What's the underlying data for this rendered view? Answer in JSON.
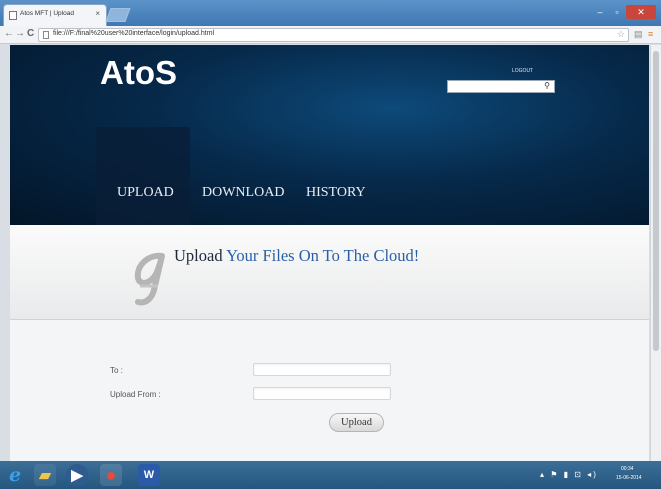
{
  "browser": {
    "tab_title": "Atos MFT | Upload",
    "tab_close": "×",
    "url": "file:///F:/final%20user%20interface/login/upload.html",
    "back": "←",
    "forward": "→",
    "reload": "C",
    "star": "☆",
    "menu": "≡",
    "extension": "▤",
    "window_controls": {
      "minimize": "–",
      "maximize": "▫",
      "close": "✕"
    }
  },
  "header": {
    "logo": "AtoS",
    "logout": "LOGOUT",
    "search_placeholder": "",
    "search_icon": "⚲"
  },
  "nav": [
    {
      "label": "UPLOAD",
      "active": true
    },
    {
      "label": "DOWNLOAD",
      "active": false
    },
    {
      "label": "HISTORY",
      "active": false
    }
  ],
  "banner": {
    "logo_glyph": "𝒜",
    "title_prefix": "Upload",
    "title_highlight": " Your Files On To The Cloud!"
  },
  "form": {
    "to_label": "To :",
    "to_value": "",
    "from_label": "Upload From :",
    "from_value": "",
    "upload_button": "Upload"
  },
  "taskbar": {
    "apps": [
      {
        "icon": "ie-icon",
        "glyph": "e",
        "color": "#3aa0e8"
      },
      {
        "icon": "explorer-folder-icon",
        "glyph": "▰",
        "color": "#f0c64a"
      },
      {
        "icon": "media-player-icon",
        "glyph": "▶",
        "color": "#ffffff"
      },
      {
        "icon": "chrome-icon",
        "glyph": "●",
        "color": "#e64b3b"
      },
      {
        "icon": "word-icon",
        "glyph": "W",
        "color": "#2b5aa8"
      }
    ],
    "tray": "▴ ⚑ ▮ ⊡ ◂)",
    "time": "00:34",
    "date": "15-06-2014"
  },
  "colors": {
    "header_bg": "#06294a",
    "accent_blue": "#2a5fa8",
    "taskbar": "#2c5f88"
  }
}
